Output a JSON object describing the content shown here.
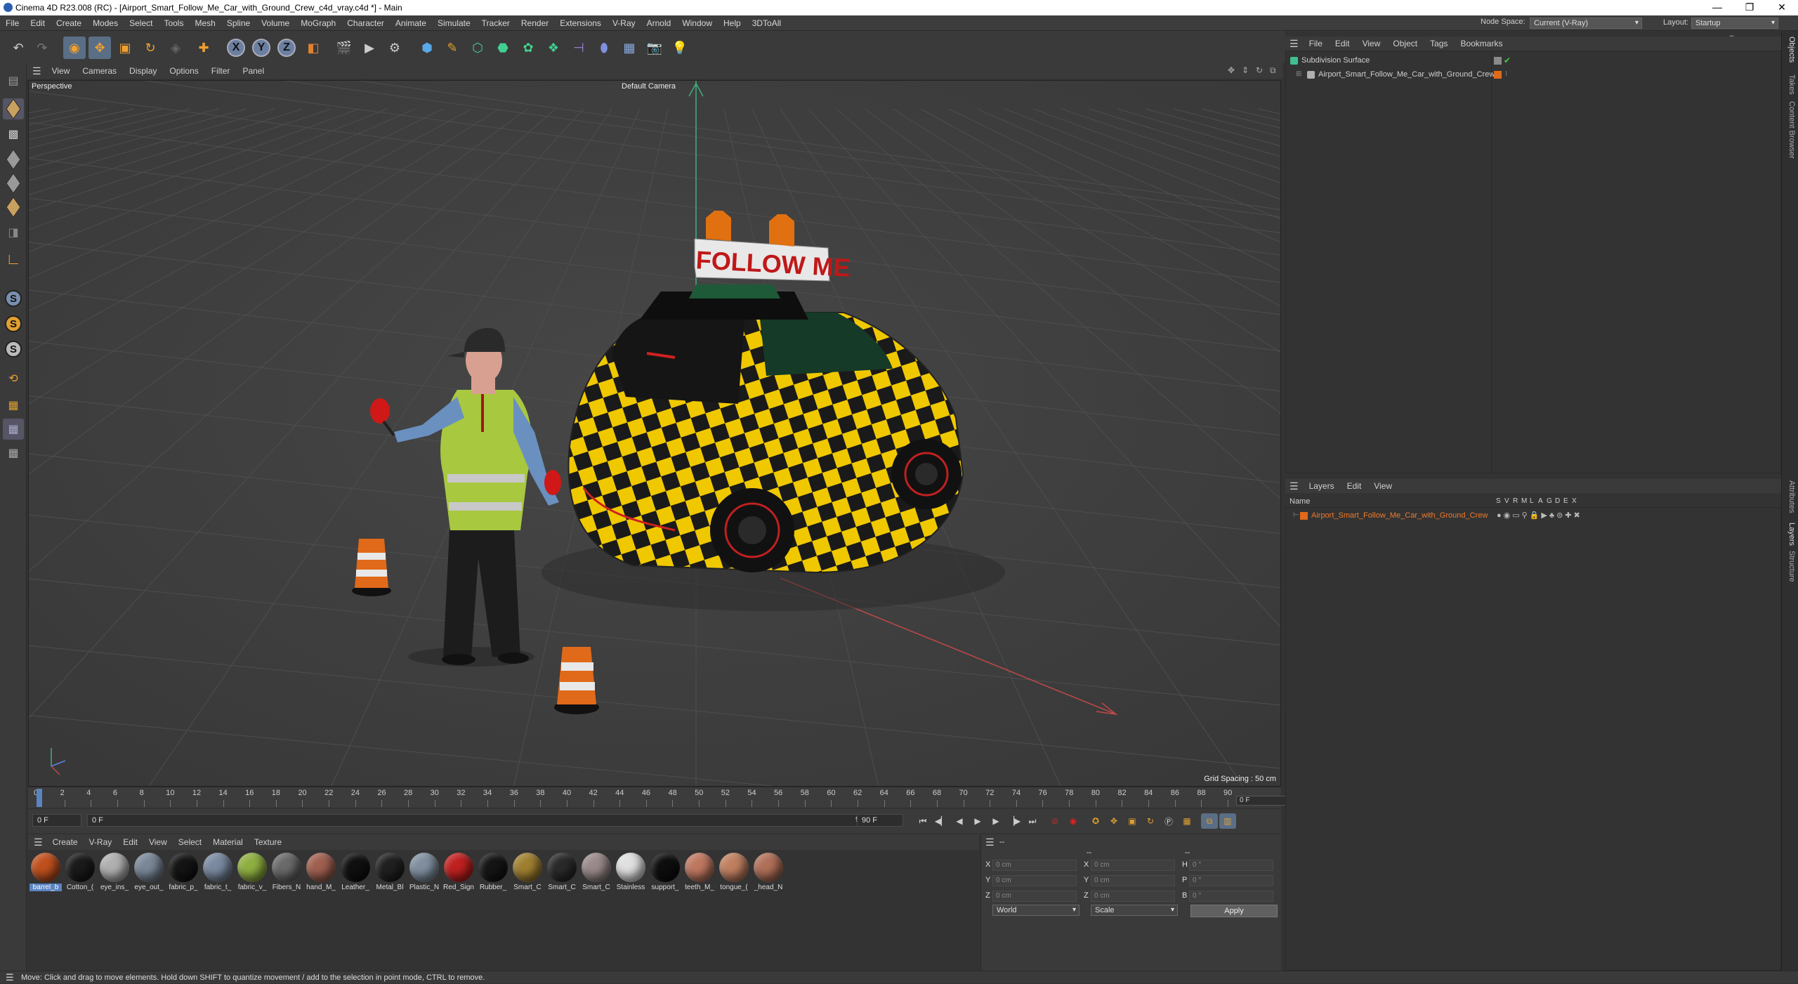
{
  "window": {
    "title": "Cinema 4D R23.008 (RC) - [Airport_Smart_Follow_Me_Car_with_Ground_Crew_c4d_vray.c4d *] - Main",
    "min": "—",
    "max": "❐",
    "close": "✕"
  },
  "menu": [
    "File",
    "Edit",
    "Create",
    "Modes",
    "Select",
    "Tools",
    "Mesh",
    "Spline",
    "Volume",
    "MoGraph",
    "Character",
    "Animate",
    "Simulate",
    "Tracker",
    "Render",
    "Extensions",
    "V-Ray",
    "Arnold",
    "Window",
    "Help",
    "3DToAll"
  ],
  "node_space": {
    "label": "Node Space:",
    "value": "Current (V-Ray)"
  },
  "layout": {
    "label": "Layout:",
    "value": "Startup"
  },
  "viewport": {
    "menu": [
      "View",
      "Cameras",
      "Display",
      "Options",
      "Filter",
      "Panel"
    ],
    "label": "Perspective",
    "camera": "Default Camera",
    "grid_spacing": "Grid Spacing : 50 cm",
    "sign_text": "FOLLOW ME"
  },
  "timeline": {
    "ticks": [
      "0",
      "2",
      "4",
      "6",
      "8",
      "10",
      "12",
      "14",
      "16",
      "18",
      "20",
      "22",
      "24",
      "26",
      "28",
      "30",
      "32",
      "34",
      "36",
      "38",
      "40",
      "42",
      "44",
      "46",
      "48",
      "50",
      "52",
      "54",
      "56",
      "58",
      "60",
      "62",
      "64",
      "66",
      "68",
      "70",
      "72",
      "74",
      "76",
      "78",
      "80",
      "82",
      "84",
      "86",
      "88",
      "90"
    ],
    "current": "0 F"
  },
  "transport": {
    "start": "0 F",
    "cur": "0 F",
    "end": "90 F",
    "end2": "90 F"
  },
  "materials": {
    "menu": [
      "Create",
      "V-Ray",
      "Edit",
      "View",
      "Select",
      "Material",
      "Texture"
    ],
    "items": [
      {
        "label": "barrel_b",
        "color": "#c0501e",
        "sel": true
      },
      {
        "label": "Cotton_(",
        "color": "#1a1a1a"
      },
      {
        "label": "eye_ins_",
        "color": "#b0b0b0"
      },
      {
        "label": "eye_out_",
        "color": "#7a8898"
      },
      {
        "label": "fabric_p_",
        "color": "#141414"
      },
      {
        "label": "fabric_t_",
        "color": "#7a8aa0"
      },
      {
        "label": "fabric_v_",
        "color": "#8fb040"
      },
      {
        "label": "Fibers_N",
        "color": "#6a6a6a"
      },
      {
        "label": "hand_M_",
        "color": "#a06050"
      },
      {
        "label": "Leather_",
        "color": "#101010"
      },
      {
        "label": "Metal_Bl",
        "color": "#202020"
      },
      {
        "label": "Plastic_N",
        "color": "#8090a0"
      },
      {
        "label": "Red_Sign",
        "color": "#c02020"
      },
      {
        "label": "Rubber_",
        "color": "#151515"
      },
      {
        "label": "Smart_C",
        "color": "#a08030"
      },
      {
        "label": "Smart_C",
        "color": "#2a2a2a"
      },
      {
        "label": "Smart_C",
        "color": "#9a8a8a"
      },
      {
        "label": "Stainless",
        "color": "#e0e0e0"
      },
      {
        "label": "support_",
        "color": "#0e0e0e"
      },
      {
        "label": "teeth_M_",
        "color": "#c07860"
      },
      {
        "label": "tongue_(",
        "color": "#c08060"
      },
      {
        "label": "_head_N",
        "color": "#b07058"
      }
    ]
  },
  "coords": {
    "header": "--",
    "col_headers": [
      "--",
      "--"
    ],
    "rows": [
      {
        "a": "X",
        "av": "0 cm",
        "b": "X",
        "bv": "0 cm",
        "c": "H",
        "cv": "0 °"
      },
      {
        "a": "Y",
        "av": "0 cm",
        "b": "Y",
        "bv": "0 cm",
        "c": "P",
        "cv": "0 °"
      },
      {
        "a": "Z",
        "av": "0 cm",
        "b": "Z",
        "bv": "0 cm",
        "c": "B",
        "cv": "0 °"
      }
    ],
    "mode": "World",
    "scale": "Scale",
    "apply": "Apply"
  },
  "objects": {
    "menu": [
      "File",
      "Edit",
      "View",
      "Object",
      "Tags",
      "Bookmarks"
    ],
    "rows": [
      {
        "label": "Subdivision Surface"
      },
      {
        "label": "Airport_Smart_Follow_Me_Car_with_Ground_Crew"
      }
    ]
  },
  "layers": {
    "menu": [
      "Layers",
      "Edit",
      "View"
    ],
    "name_header": "Name",
    "flags": [
      "S",
      "V",
      "R",
      "M",
      "L",
      "A",
      "G",
      "D",
      "E",
      "X"
    ],
    "rows": [
      {
        "label": "Airport_Smart_Follow_Me_Car_with_Ground_Crew",
        "color": "#e06a1a"
      }
    ]
  },
  "right_tabs": [
    "Objects",
    "Takes",
    "Content Browser",
    "Attributes",
    "Layers",
    "Structure"
  ],
  "status": "Move: Click and drag to move elements. Hold down SHIFT to quantize movement / add to the selection in point mode, CTRL to remove.",
  "colors": {
    "accent": "#5a84c0",
    "x_axis": "#d04040",
    "y_axis": "#40c080",
    "car_yellow": "#f0c800"
  }
}
